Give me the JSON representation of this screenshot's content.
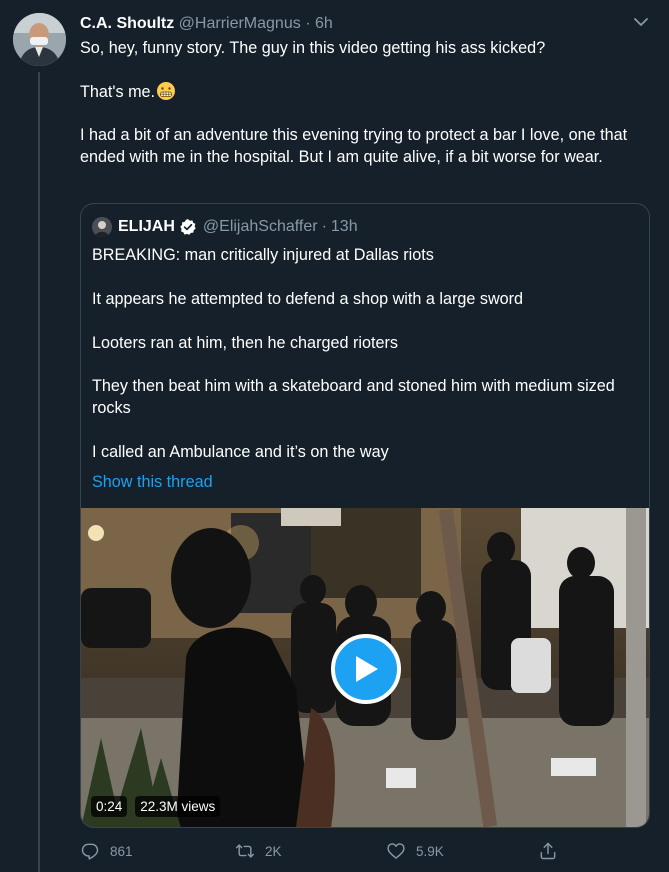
{
  "tweet": {
    "author_name": "C.A. Shoultz",
    "author_handle": "@HarrierMagnus",
    "separator": "·",
    "time": "6h",
    "text_line1": "So, hey, funny story. The guy in this video getting his ass kicked?",
    "text_line2": "That's me.",
    "emoji": "grimacing-face-emoji",
    "text_line3": "I had a bit of an adventure this evening trying to protect a bar I love, one that ended with me in the hospital. But I am quite alive, if a bit worse for wear."
  },
  "quoted": {
    "author_name": "ELIJAH",
    "author_handle": "@ElijahSchaffer",
    "separator": "·",
    "time": "13h",
    "paragraphs": [
      "BREAKING: man critically injured at Dallas riots",
      "It appears he attempted to defend a shop with a large sword",
      "Looters ran at him, then he charged rioters",
      "They then beat him with a skateboard and stoned him with medium sized rocks",
      "I called an Ambulance and it’s on the way"
    ],
    "show_thread": "Show this thread",
    "video": {
      "duration": "0:24",
      "views": "22.3M views"
    }
  },
  "actions": {
    "replies": "861",
    "retweets": "2K",
    "likes": "5.9K"
  },
  "colors": {
    "background": "#15202b",
    "accent": "#1da1f2",
    "muted": "#8899a6",
    "border": "#38444d"
  }
}
